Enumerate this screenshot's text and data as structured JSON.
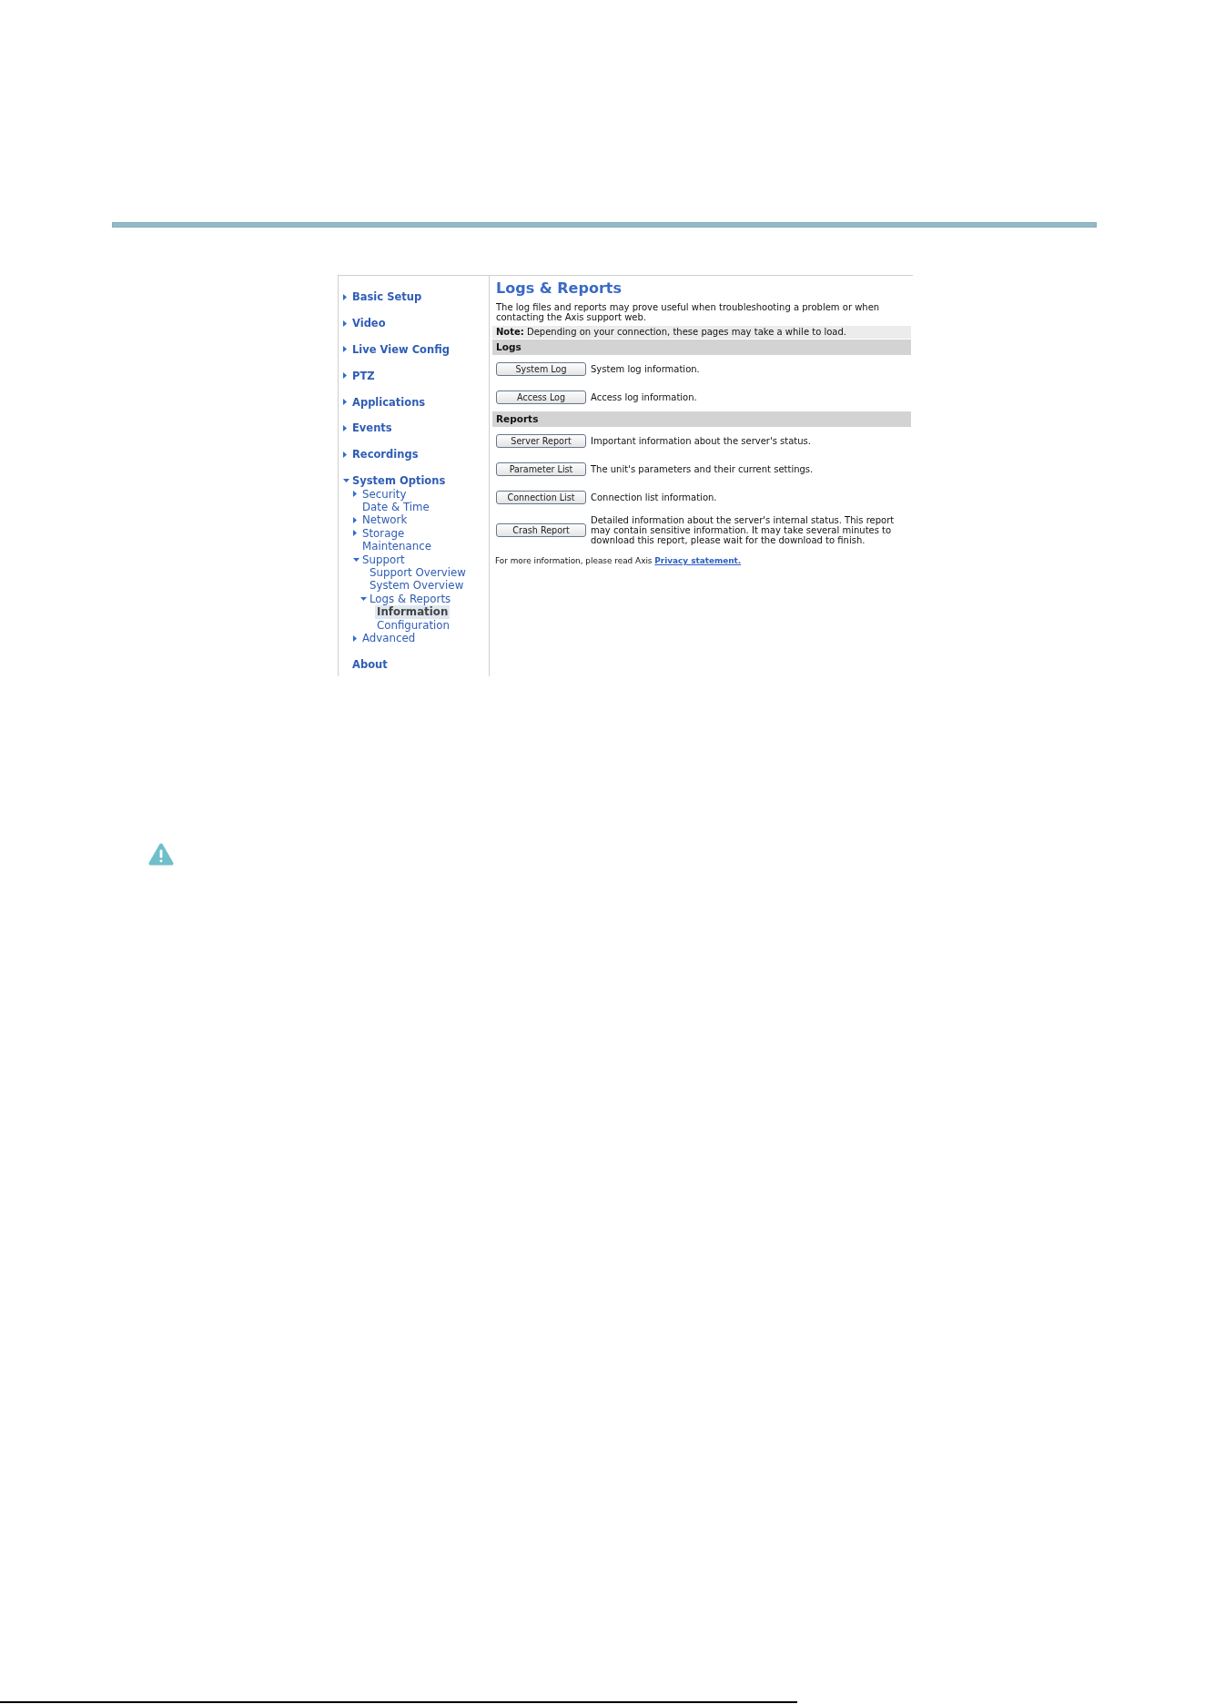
{
  "sidebar": {
    "items": [
      {
        "kind": "group",
        "label": "Basic Setup",
        "expanded": false,
        "selected": false
      },
      {
        "kind": "group",
        "label": "Video",
        "expanded": false,
        "selected": false
      },
      {
        "kind": "group",
        "label": "Live View Config",
        "expanded": false,
        "selected": false
      },
      {
        "kind": "group",
        "label": "PTZ",
        "expanded": false,
        "selected": false
      },
      {
        "kind": "group",
        "label": "Applications",
        "expanded": false,
        "selected": false
      },
      {
        "kind": "group",
        "label": "Events",
        "expanded": false,
        "selected": false
      },
      {
        "kind": "group",
        "label": "Recordings",
        "expanded": false,
        "selected": false
      },
      {
        "kind": "group",
        "label": "System Options",
        "expanded": true,
        "selected": false,
        "children": [
          {
            "kind": "group",
            "label": "Security",
            "expanded": false,
            "selected": false
          },
          {
            "kind": "page",
            "label": "Date & Time",
            "selected": false
          },
          {
            "kind": "group",
            "label": "Network",
            "expanded": false,
            "selected": false
          },
          {
            "kind": "group",
            "label": "Storage",
            "expanded": false,
            "selected": false
          },
          {
            "kind": "page",
            "label": "Maintenance",
            "selected": false
          },
          {
            "kind": "group",
            "label": "Support",
            "expanded": true,
            "selected": false,
            "children": [
              {
                "kind": "page",
                "label": "Support Overview",
                "selected": false
              },
              {
                "kind": "page",
                "label": "System Overview",
                "selected": false
              },
              {
                "kind": "group",
                "label": "Logs & Reports",
                "expanded": true,
                "selected": false,
                "children": [
                  {
                    "kind": "page",
                    "label": "Information",
                    "selected": true
                  },
                  {
                    "kind": "page",
                    "label": "Configuration",
                    "selected": false
                  }
                ]
              }
            ]
          },
          {
            "kind": "group",
            "label": "Advanced",
            "expanded": false,
            "selected": false
          }
        ]
      },
      {
        "kind": "page",
        "label": "About",
        "selected": false
      }
    ]
  },
  "content": {
    "title": "Logs & Reports",
    "intro": "The log files and reports may prove useful when troubleshooting a problem or when contacting the Axis support web.",
    "note": "**Note:** Depending on your connection, these pages may take a while to load.",
    "sections": [
      {
        "heading": "Logs",
        "rows": [
          {
            "button": "System Log",
            "description": "System log information."
          },
          {
            "button": "Access Log",
            "description": "Access log information."
          }
        ]
      },
      {
        "heading": "Reports",
        "rows": [
          {
            "button": "Server Report",
            "description": "Important information about the server's status."
          },
          {
            "button": "Parameter List",
            "description": "The unit's parameters and their current settings."
          },
          {
            "button": "Connection List",
            "description": "Connection list information."
          },
          {
            "button": "Crash Report",
            "description": "Detailed information about the server's internal status. This report may contain sensitive information. It may take several minutes to download this report, please wait for the download to finish."
          }
        ]
      }
    ],
    "footer": {
      "text": "For more information, please read Axis",
      "link": "Privacy statement."
    }
  }
}
